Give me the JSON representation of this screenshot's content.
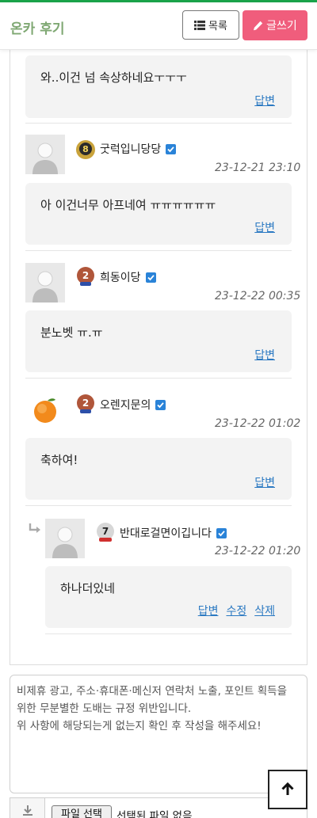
{
  "header": {
    "title": "온카 후기",
    "list_label": "목록",
    "write_label": "글쓰기",
    "write_color": "#f05d7c",
    "title_color": "#7fa873"
  },
  "comments": [
    {
      "text": "와..이건 넘 속상하네요ㅜㅜㅜ",
      "actions": [
        "답변"
      ]
    },
    {
      "nick": "굿럭입니당당",
      "level": "8",
      "date": "23-12-21 23:10",
      "avatar": "default-avatar",
      "text": "아 이건너무 아프네여 ㅠㅠㅠㅠㅠㅠ",
      "actions": [
        "답변"
      ]
    },
    {
      "nick": "희동이당",
      "level": "2",
      "date": "23-12-22 00:35",
      "avatar": "default-avatar",
      "text": "분노벳 ㅠ.ㅠ",
      "actions": [
        "답변"
      ]
    },
    {
      "nick": "오렌지문의",
      "level": "2",
      "date": "23-12-22 01:02",
      "avatar": "orange-avatar",
      "text": "축하여!",
      "actions": [
        "답변"
      ]
    },
    {
      "nick": "반대로걸면이깁니다",
      "level": "7",
      "date": "23-12-22 01:20",
      "avatar": "default-avatar",
      "text": "하나더있네",
      "actions": [
        "답변",
        "수정",
        "삭제"
      ],
      "is_reply": true
    }
  ],
  "editor": {
    "line1": "비제휴 광고, 주소·휴대폰·메신저 연락처 노출, 포인트 획득을",
    "line2": "위한 무분별한 도배는 규정 위반입니다.",
    "line3": "위 사항에 해당되는게 없는지 확인 후 작성을 해주세요!"
  },
  "file": {
    "button_label": "파일 선택",
    "status": "선택된 파일 없음"
  },
  "icons": {
    "list": "list-icon",
    "write": "pencil-icon",
    "scroll_top": "arrow-up-icon",
    "reply": "reply-arrow-icon",
    "verified": "check-badge-icon",
    "download": "download-icon"
  },
  "colors": {
    "link": "#2b79c2",
    "verified": "#2a83d8",
    "comment_bg": "#f3f3f3"
  }
}
